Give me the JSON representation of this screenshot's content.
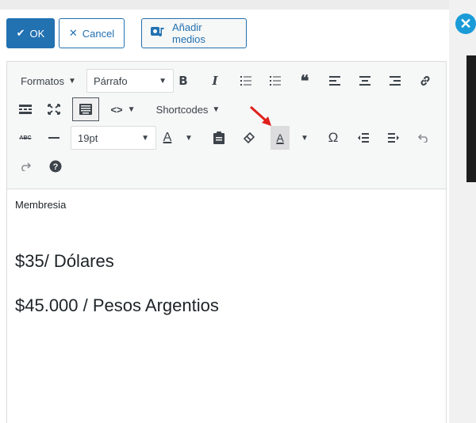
{
  "dialog": {
    "ok_label": "OK",
    "cancel_label": "Cancel",
    "add_media_label": "Añadir medios"
  },
  "toolbar": {
    "formats_label": "Formatos",
    "paragraph_select": "Párrafo",
    "shortcodes_label": "Shortcodes",
    "font_size_select": "19pt"
  },
  "content": {
    "line1": "Membresia",
    "line2": "$35/ Dólares",
    "line3": "$45.000 / Pesos Argentios"
  },
  "colors": {
    "primary": "#2271b1",
    "close_button": "#1a9bd7",
    "annotation_arrow": "#e0201c"
  }
}
